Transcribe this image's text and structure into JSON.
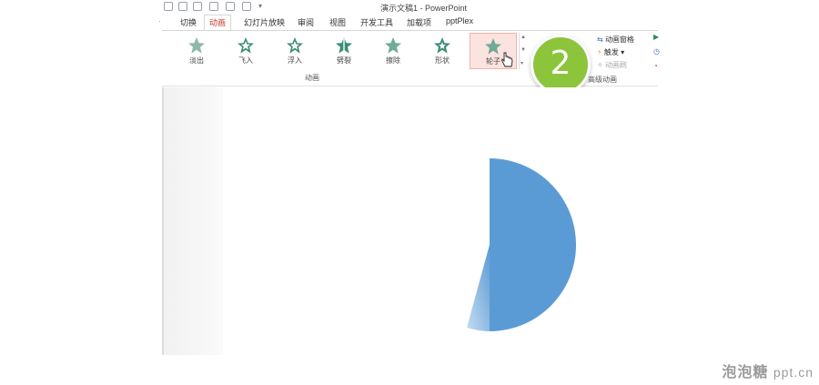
{
  "window": {
    "title": "演示文稿1 - PowerPoint"
  },
  "tabs": [
    {
      "label": "切换"
    },
    {
      "label": "动画",
      "active": true
    },
    {
      "label": "幻灯片放映"
    },
    {
      "label": "审阅"
    },
    {
      "label": "视图"
    },
    {
      "label": "开发工具"
    },
    {
      "label": "加载项"
    },
    {
      "label": "pptPlex"
    }
  ],
  "animation_gallery": {
    "items": [
      {
        "label": "淡出",
        "icon": "fade-star-icon"
      },
      {
        "label": "飞入",
        "icon": "fly-in-star-icon"
      },
      {
        "label": "浮入",
        "icon": "float-in-star-icon"
      },
      {
        "label": "劈裂",
        "icon": "split-star-icon"
      },
      {
        "label": "擦除",
        "icon": "wipe-star-icon"
      },
      {
        "label": "形状",
        "icon": "shape-star-icon"
      },
      {
        "label": "轮子",
        "icon": "wheel-star-icon",
        "selected": true
      }
    ],
    "group_label": "动画"
  },
  "advanced_animation": {
    "items": [
      {
        "label": "动画窗格",
        "enabled": true
      },
      {
        "label": "触发",
        "enabled": true
      },
      {
        "label": "动画刷",
        "enabled": false
      }
    ],
    "group_label": "高级动画"
  },
  "step_badge": {
    "number": "2",
    "color": "#8cc43b"
  },
  "slide": {
    "shape": "wheel-animation-shape",
    "fill": "#5b9bd5"
  },
  "watermark": {
    "brand": "泡泡糖",
    "domain": "ppt.cn"
  }
}
